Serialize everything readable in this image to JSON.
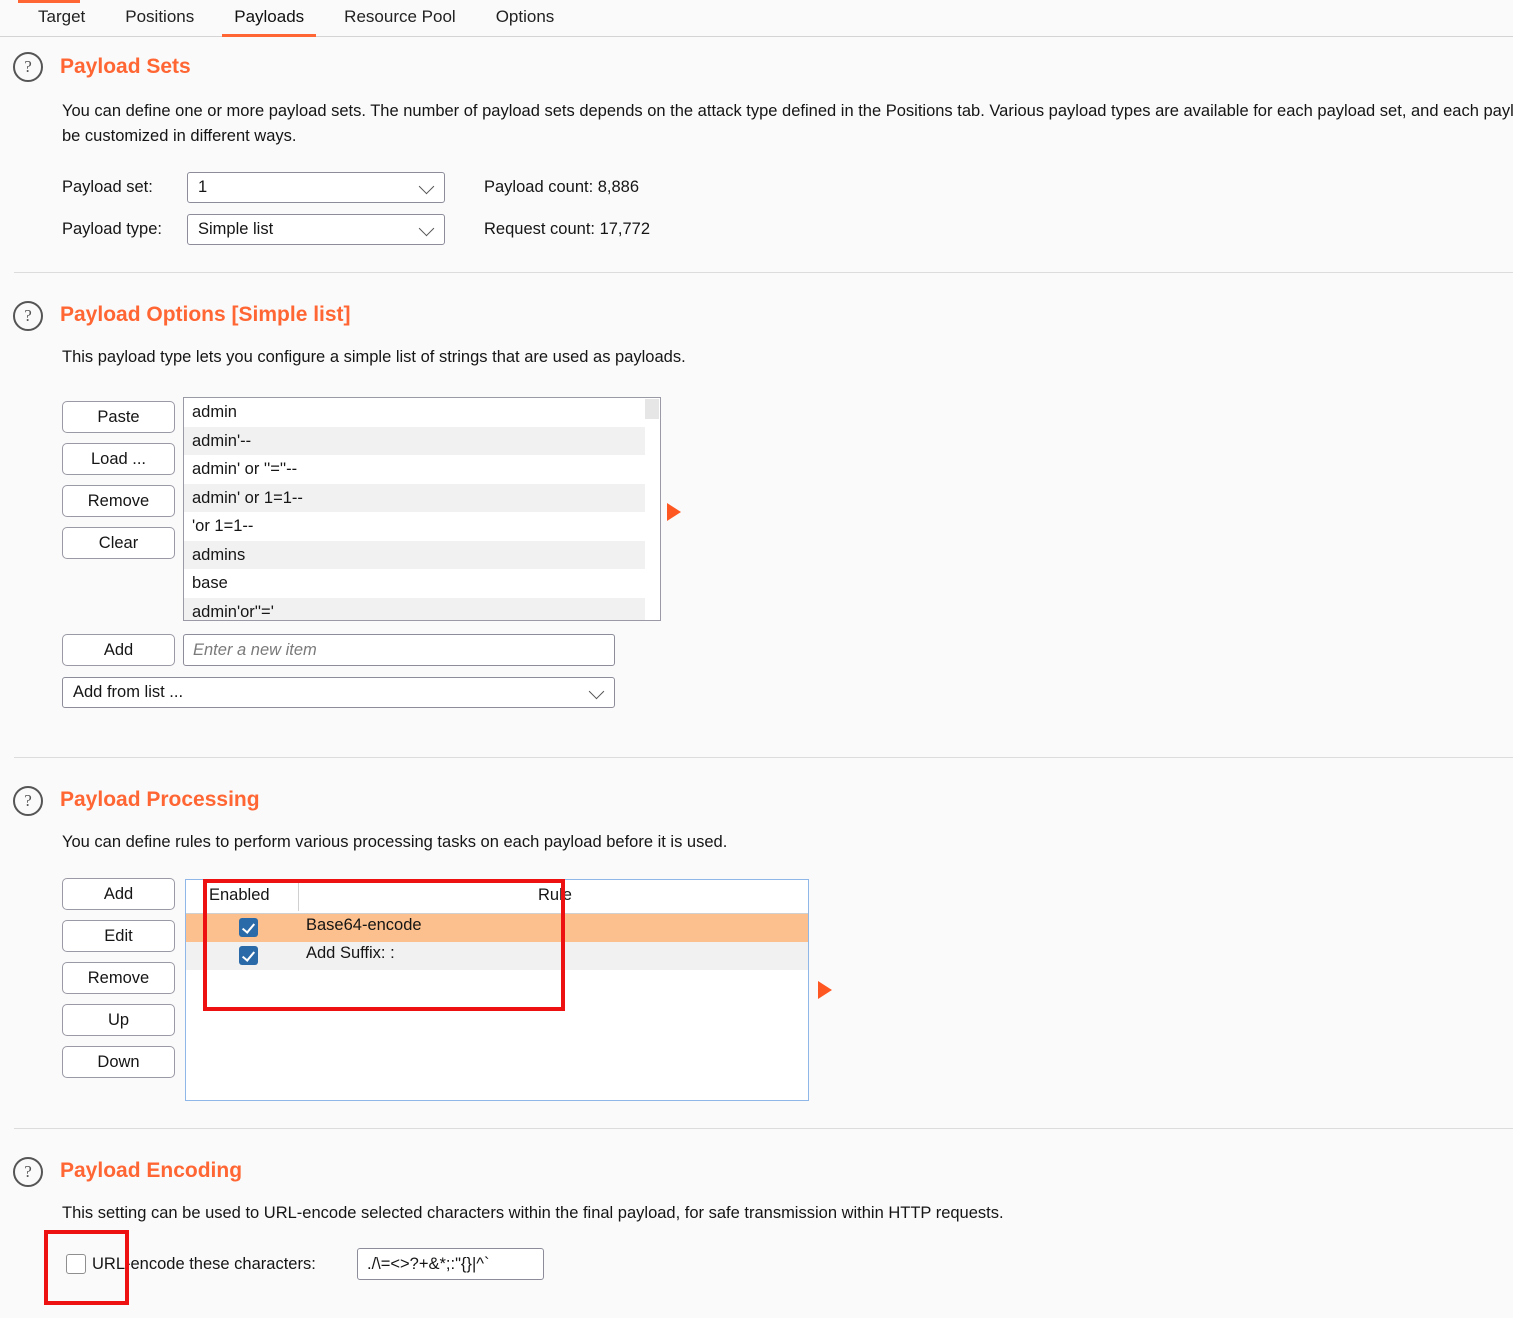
{
  "tabs": [
    {
      "label": "Target",
      "active": false
    },
    {
      "label": "Positions",
      "active": false
    },
    {
      "label": "Payloads",
      "active": true
    },
    {
      "label": "Resource Pool",
      "active": false
    },
    {
      "label": "Options",
      "active": false
    }
  ],
  "help_icon": "?",
  "payload_sets": {
    "title": "Payload Sets",
    "description_line1": "You can define one or more payload sets. The number of payload sets depends on the attack type defined in the Positions tab. Various payload types are available for each payload set, and each payload type can",
    "description_line2": "be customized in different ways.",
    "payload_set_label": "Payload set:",
    "payload_set_value": "1",
    "payload_type_label": "Payload type:",
    "payload_type_value": "Simple list",
    "payload_count_label": "Payload count: 8,886",
    "request_count_label": "Request count: 17,772"
  },
  "payload_options": {
    "title": "Payload Options [Simple list]",
    "description": "This payload type lets you configure a simple list of strings that are used as payloads.",
    "buttons": [
      {
        "label": "Paste"
      },
      {
        "label": "Load ..."
      },
      {
        "label": "Remove"
      },
      {
        "label": "Clear"
      }
    ],
    "items": [
      "admin",
      "admin'--",
      "admin' or ''=''--",
      "admin' or 1=1--",
      "'or 1=1--",
      "admins",
      "base",
      "admin'or''='"
    ],
    "add_button": "Add",
    "add_input_placeholder": "Enter a new item",
    "add_from_list": "Add from list ..."
  },
  "payload_processing": {
    "title": "Payload Processing",
    "description": "You can define rules to perform various processing tasks on each payload before it is used.",
    "buttons": [
      {
        "label": "Add"
      },
      {
        "label": "Edit"
      },
      {
        "label": "Remove"
      },
      {
        "label": "Up"
      },
      {
        "label": "Down"
      }
    ],
    "columns": {
      "enabled": "Enabled",
      "rule": "Rule"
    },
    "rules": [
      {
        "enabled": true,
        "name": "Base64-encode",
        "selected": true
      },
      {
        "enabled": true,
        "name": "Add Suffix: :",
        "selected": false
      }
    ]
  },
  "payload_encoding": {
    "title": "Payload Encoding",
    "description": "This setting can be used to URL-encode selected characters within the final payload, for safe transmission within HTTP requests.",
    "checkbox_checked": false,
    "checkbox_label": "URL-encode these characters:",
    "characters_value": "./\\=<>?+&*;:\"{}|^`"
  },
  "colors": {
    "accent_orange": "#ff6633",
    "marker_orange": "#ff5722",
    "selected_row": "#fbc08d",
    "checkbox_blue": "#2b6aa8",
    "annotation_red": "#ee1111"
  }
}
